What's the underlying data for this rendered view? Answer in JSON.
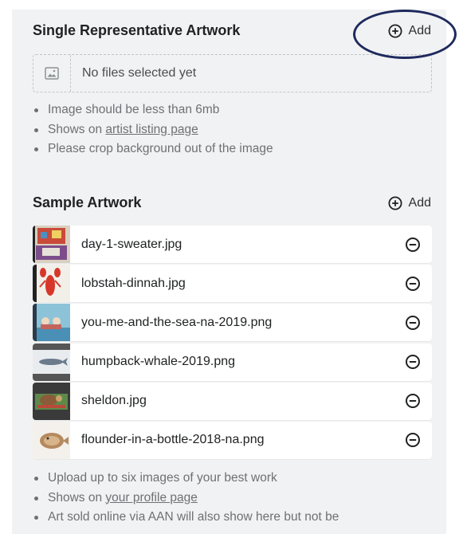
{
  "single": {
    "title": "Single Representative Artwork",
    "add_label": "Add",
    "dropzone_text": "No files selected yet",
    "bullets": [
      {
        "text": "Image should be less than 6mb"
      },
      {
        "prefix": "Shows on ",
        "link": "artist listing page"
      },
      {
        "text": "Please crop background out of the image"
      }
    ]
  },
  "sample": {
    "title": "Sample Artwork",
    "add_label": "Add",
    "files": [
      {
        "name": "day-1-sweater.jpg"
      },
      {
        "name": "lobstah-dinnah.jpg"
      },
      {
        "name": "you-me-and-the-sea-na-2019.png"
      },
      {
        "name": "humpback-whale-2019.png"
      },
      {
        "name": "sheldon.jpg"
      },
      {
        "name": "flounder-in-a-bottle-2018-na.png"
      }
    ],
    "bullets": [
      {
        "text": "Upload up to six images of your best work"
      },
      {
        "prefix": "Shows on ",
        "link": "your profile page"
      },
      {
        "text": "Art sold online via AAN will also show here but not be"
      }
    ]
  },
  "colors": {
    "panel_bg": "#f1f2f3",
    "highlight_ring": "#1e2a5e"
  }
}
